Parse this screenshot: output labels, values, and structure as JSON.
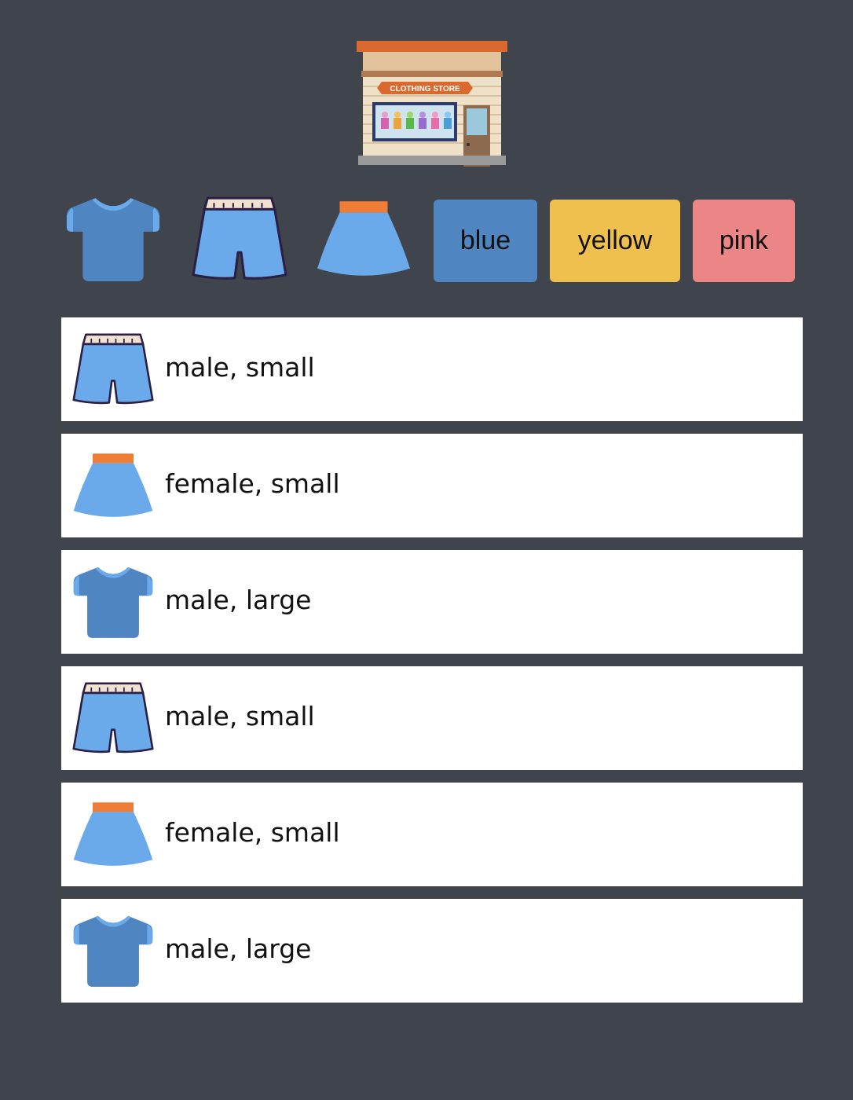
{
  "store": {
    "icon": "clothing-store-icon",
    "sign_text": "CLOTHING STORE"
  },
  "toolbar": {
    "clothing_icons": [
      "tshirt-icon",
      "shorts-icon",
      "skirt-icon"
    ],
    "color_buttons": [
      {
        "label": "blue",
        "color": "#4f86c1"
      },
      {
        "label": "yellow",
        "color": "#f0c04f"
      },
      {
        "label": "pink",
        "color": "#ec8585"
      }
    ]
  },
  "items": [
    {
      "icon": "shorts-icon",
      "label": "male, small"
    },
    {
      "icon": "skirt-icon",
      "label": "female, small"
    },
    {
      "icon": "tshirt-icon",
      "label": "male, large"
    },
    {
      "icon": "shorts-icon",
      "label": "male, small"
    },
    {
      "icon": "skirt-icon",
      "label": "female, small"
    },
    {
      "icon": "tshirt-icon",
      "label": "male, large"
    }
  ]
}
